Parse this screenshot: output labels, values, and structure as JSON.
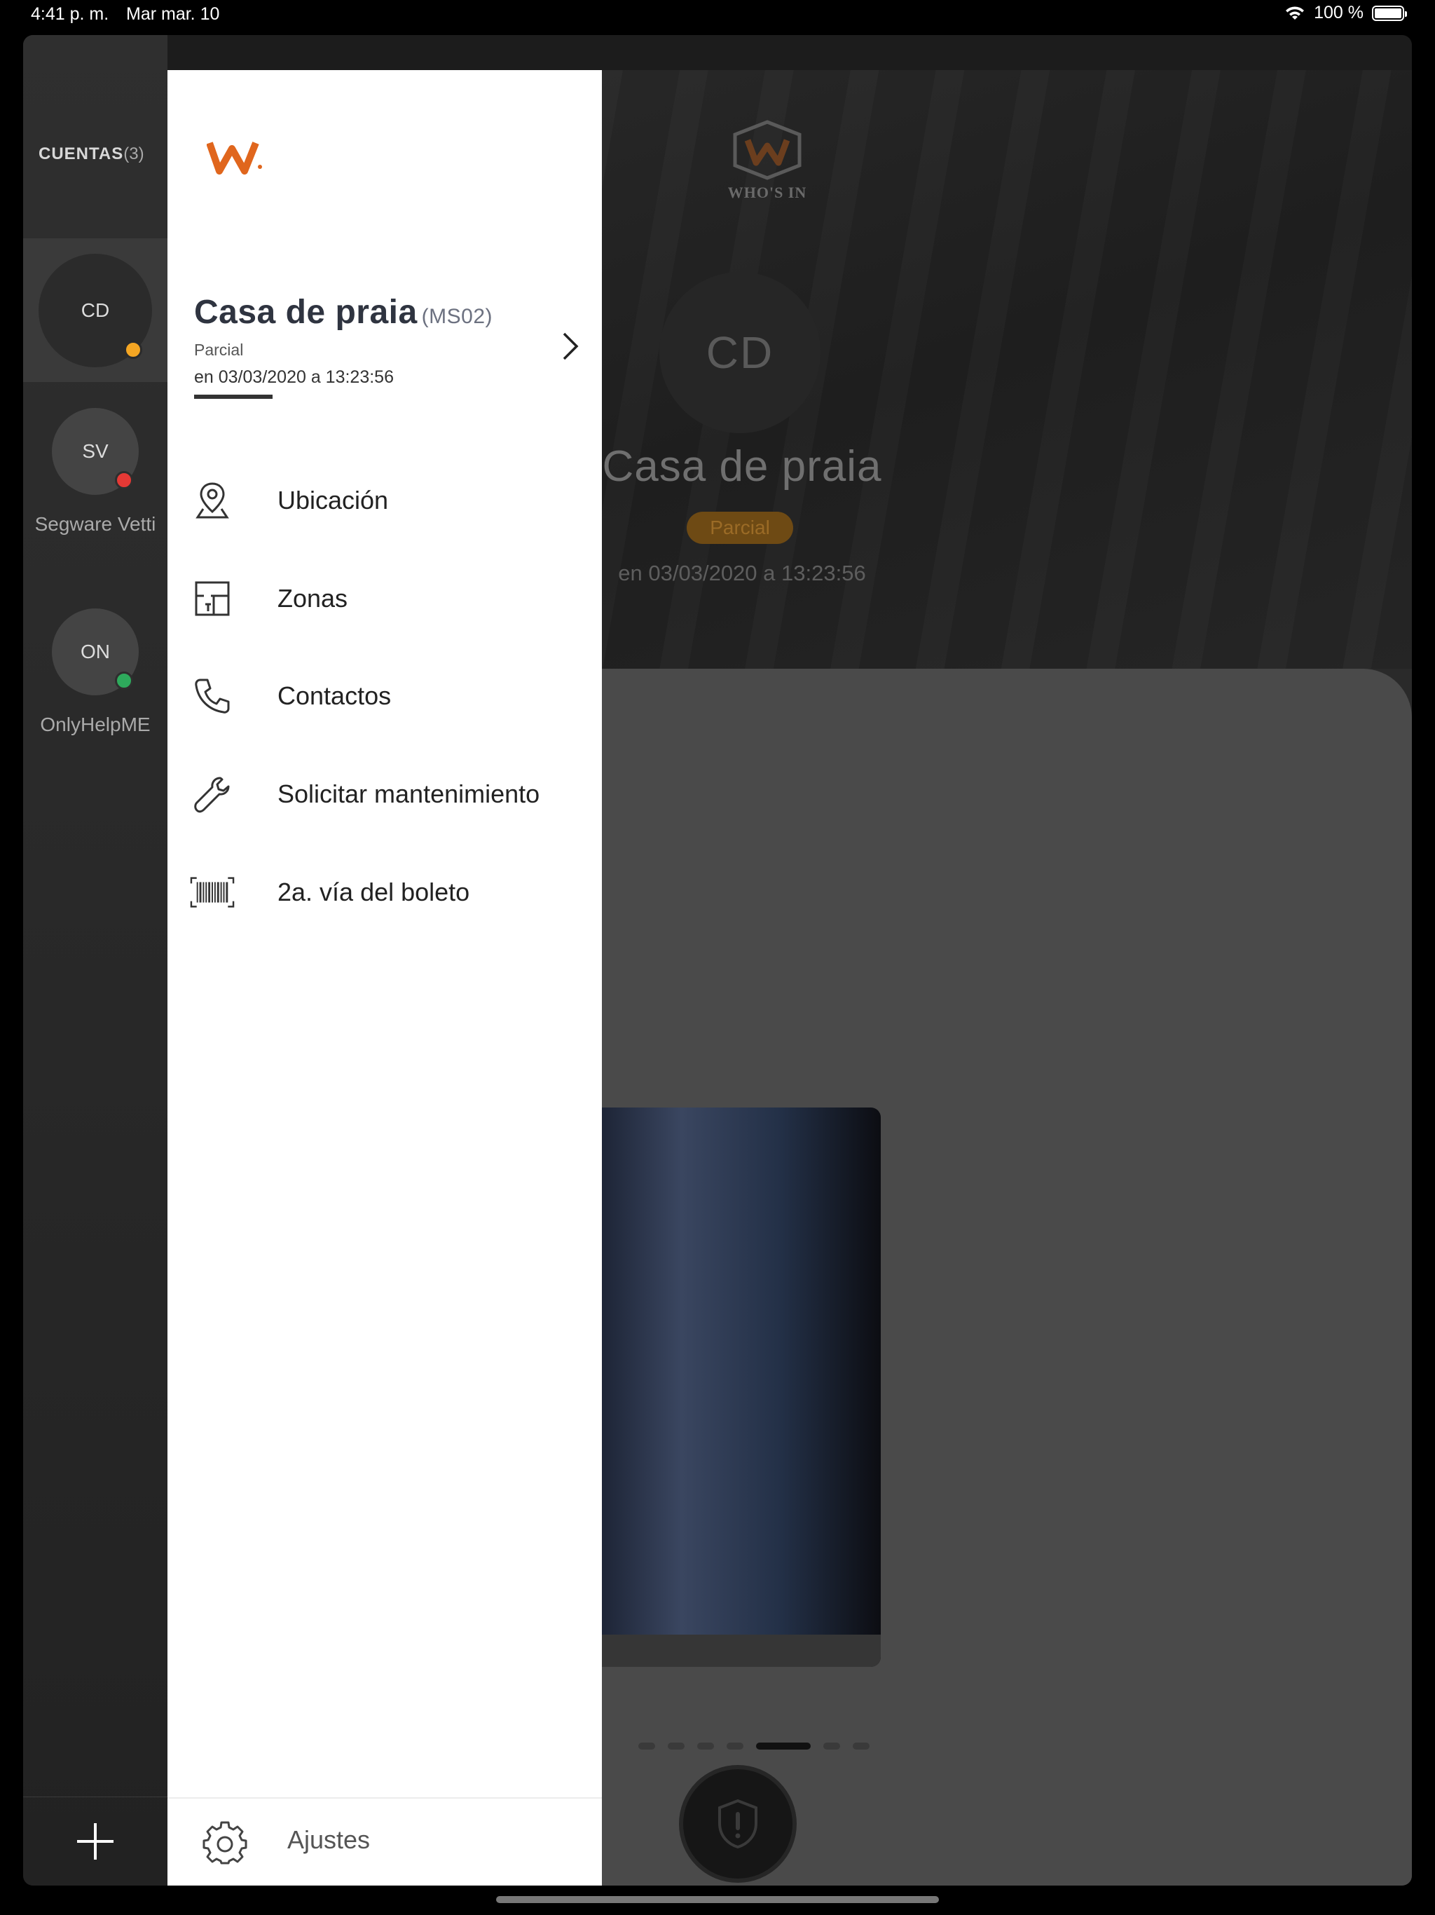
{
  "status_bar": {
    "time": "4:41 p. m.",
    "date": "Mar mar. 10",
    "battery": "100 %"
  },
  "rail": {
    "label": "CUENTAS",
    "count": "(3)",
    "accounts": [
      {
        "initials": "CD",
        "name": "",
        "status_color": "#f5a623",
        "active": true
      },
      {
        "initials": "SV",
        "name": "Segware Vetti",
        "status_color": "#e53935",
        "active": false
      },
      {
        "initials": "ON",
        "name": "OnlyHelpME",
        "status_color": "#2eaa5c",
        "active": false
      }
    ],
    "add_icon": "plus-icon"
  },
  "background": {
    "brand": "WHO'S IN",
    "avatar_initials": "CD",
    "title": "Casa de praia",
    "badge": "Parcial",
    "timestamp": "en 03/03/2020 a 13:23:56",
    "sos_icon": "shield-alert-icon"
  },
  "drawer": {
    "account_name": "Casa de praia",
    "account_code": "(MS02)",
    "status": "Parcial",
    "timestamp": "en 03/03/2020 a 13:23:56",
    "menu": [
      {
        "label": "Ubicación",
        "icon": "location-pin-icon"
      },
      {
        "label": "Zonas",
        "icon": "floorplan-icon"
      },
      {
        "label": "Contactos",
        "icon": "phone-icon"
      },
      {
        "label": "Solicitar mantenimiento",
        "icon": "wrench-icon"
      },
      {
        "label": "2a. vía del boleto",
        "icon": "barcode-icon"
      }
    ],
    "settings_label": "Ajustes"
  },
  "colors": {
    "brand_orange": "#e0661d",
    "status_partial": "#f5a623",
    "status_alarm": "#e53935",
    "status_ok": "#2eaa5c"
  }
}
